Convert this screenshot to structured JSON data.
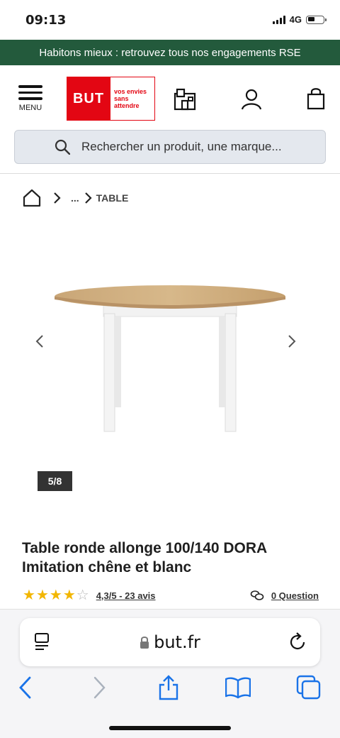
{
  "status_bar": {
    "time": "09:13",
    "network": "4G"
  },
  "banner": {
    "text": "Habitons mieux : retrouvez tous nos engagements RSE"
  },
  "header": {
    "menu_label": "MENU",
    "logo_text": "BUT",
    "logo_tagline": "vos envies sans attendre"
  },
  "search": {
    "placeholder": "Rechercher un produit, une marque..."
  },
  "breadcrumb": {
    "ellipsis": "...",
    "current": "TABLE"
  },
  "gallery": {
    "counter": "5/8",
    "current_image": 5,
    "total_images": 8
  },
  "product": {
    "title_line1": "Table ronde allonge 100/140 DORA",
    "title_line2": "Imitation chêne et blanc",
    "rating_value": 4.3,
    "rating_text": "4,3/5 - 23 avis",
    "question_text": "0 Question"
  },
  "browser": {
    "url": "but.fr"
  },
  "colors": {
    "brand_red": "#e30613",
    "banner_green": "#235a3c",
    "star_yellow": "#f2b600",
    "link_blue": "#1a73e8"
  }
}
